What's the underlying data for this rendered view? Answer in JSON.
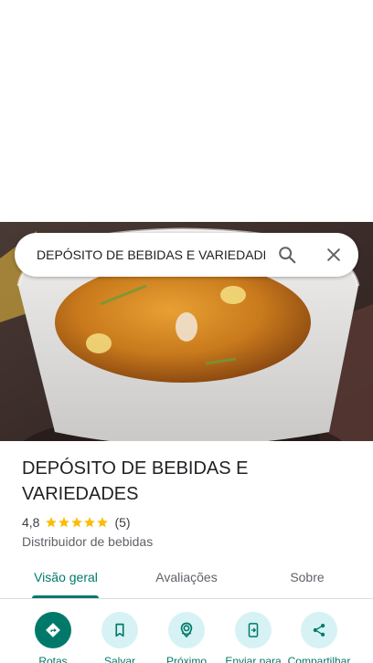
{
  "search": {
    "query": "DEPÓSITO DE BEBIDAS E VARIEDADES"
  },
  "place": {
    "name": "DEPÓSITO DE BEBIDAS E VARIEDADES",
    "rating": "4,8",
    "stars": 5,
    "review_count": "(5)",
    "category": "Distribuidor de bebidas"
  },
  "tabs": [
    {
      "label": "Visão geral",
      "active": true
    },
    {
      "label": "Avaliações",
      "active": false
    },
    {
      "label": "Sobre",
      "active": false
    }
  ],
  "actions": [
    {
      "label": "Rotas",
      "icon": "directions-icon"
    },
    {
      "label": "Salvar",
      "icon": "bookmark-icon"
    },
    {
      "label": "Próximo",
      "icon": "nearby-icon"
    },
    {
      "label": "Enviar para",
      "icon": "send-to-phone-icon"
    },
    {
      "label": "Compartilhar",
      "icon": "share-icon"
    }
  ],
  "colors": {
    "accent": "#00796b",
    "action_bg": "#d7f2f4",
    "star": "#fbbc04"
  }
}
